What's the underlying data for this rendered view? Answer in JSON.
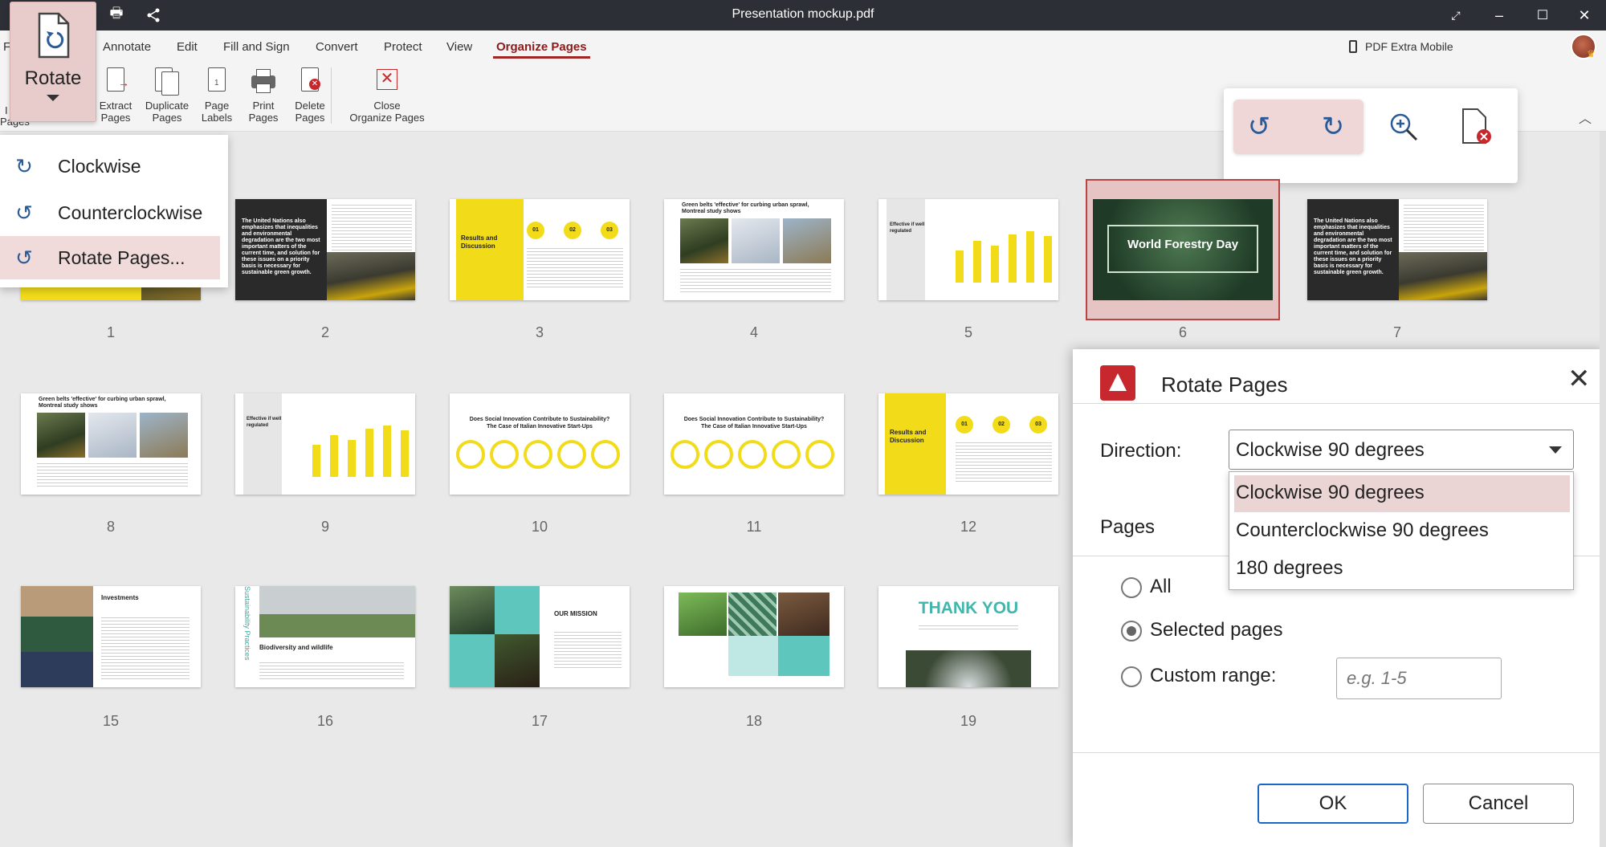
{
  "window": {
    "title": "Presentation mockup.pdf"
  },
  "menu": {
    "items": [
      "F",
      "Annotate",
      "Edit",
      "Fill and Sign",
      "Convert",
      "Protect",
      "View",
      "Organize Pages"
    ],
    "active": "Organize Pages",
    "mobile_link": "PDF Extra Mobile"
  },
  "ribbon": {
    "rotate_label": "Rotate",
    "left_partial_1": "I",
    "left_partial_2": "Pages",
    "buttons": [
      {
        "line1": "Extract",
        "line2": "Pages",
        "icon": "extract-icon"
      },
      {
        "line1": "Duplicate",
        "line2": "Pages",
        "icon": "duplicate-icon"
      },
      {
        "line1": "Page",
        "line2": "Labels",
        "icon": "page-labels-icon"
      },
      {
        "line1": "Print",
        "line2": "Pages",
        "icon": "print-icon"
      },
      {
        "line1": "Delete",
        "line2": "Pages",
        "icon": "delete-icon"
      },
      {
        "line1": "Close",
        "line2": "Organize Pages",
        "icon": "close-icon"
      }
    ]
  },
  "rotate_menu": {
    "items": [
      "Clockwise",
      "Counterclockwise",
      "Rotate Pages..."
    ],
    "highlighted": "Rotate Pages..."
  },
  "floating_toolbar": {
    "icons": [
      "rotate-counterclockwise-icon",
      "rotate-clockwise-icon",
      "zoom-in-icon",
      "delete-page-icon"
    ]
  },
  "pages": {
    "numbers": [
      "1",
      "2",
      "3",
      "4",
      "5",
      "6",
      "7",
      "8",
      "9",
      "10",
      "11",
      "12",
      "15",
      "16",
      "17",
      "18",
      "19"
    ],
    "selected": "6",
    "p2_quote": "The United Nations also emphasizes that inequalities and environmental degradation are the two most important matters of the current time, and solution for these issues on a priority basis is necessary for sustainable green growth.",
    "p3_title": "Results and Discussion",
    "p3_badges": [
      "01",
      "02",
      "03"
    ],
    "p4_title": "Green belts 'effective' for curbing urban sprawl, Montreal study shows",
    "p5_title": "Effective if well regulated",
    "p6_title": "World Forestry Day",
    "p10_title": "Does Social Innovation Contribute to Sustainability? The Case of Italian Innovative Start-Ups",
    "p15_title": "Investments",
    "p16_title": "Biodiversity and wildlife",
    "p16_side": "Sustainability Practices",
    "p17_title": "OUR MISSION",
    "p19_title": "THANK YOU"
  },
  "dialog": {
    "title": "Rotate Pages",
    "direction_label": "Direction:",
    "direction_value": "Clockwise 90 degrees",
    "direction_options": [
      "Clockwise 90 degrees",
      "Counterclockwise 90 degrees",
      "180 degrees"
    ],
    "pages_label": "Pages",
    "radio_all": "All",
    "radio_selected": "Selected pages",
    "radio_custom": "Custom range:",
    "range_placeholder": "e.g. 1-5",
    "ok": "OK",
    "cancel": "Cancel"
  },
  "colors": {
    "accent": "#a02626",
    "highlight": "#ebd4d4",
    "titlebar": "#2c2f35",
    "slide_yellow": "#f2dc1a"
  }
}
